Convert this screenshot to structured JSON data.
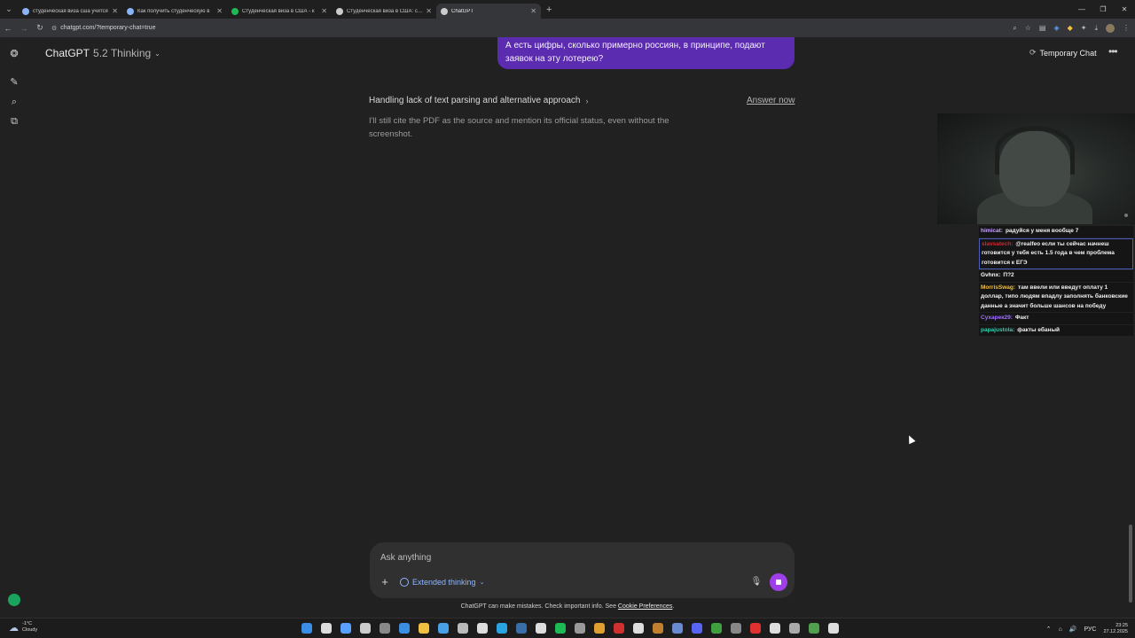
{
  "browser": {
    "tabs": [
      {
        "title": "студенческая виза сша учится",
        "favicon_color": "#8ab4f8"
      },
      {
        "title": "Как получить студенческую в",
        "favicon_color": "#8ab4f8"
      },
      {
        "title": "Студенческая виза в США - к",
        "favicon_color": "#1db954"
      },
      {
        "title": "Студенческая виза в США: сам",
        "favicon_color": "#cccccc"
      },
      {
        "title": "ChatGPT",
        "favicon_color": "#cccccc",
        "active": true
      }
    ],
    "url": "chatgpt.com/?temporary-chat=true"
  },
  "header": {
    "model_name": "ChatGPT",
    "model_version": "5.2 Thinking",
    "temporary_chat_label": "Temporary Chat"
  },
  "conversation": {
    "user_message": "А есть цифры, сколько примерно россиян, в принципе, подают заявок на эту лотерею?",
    "thinking_title": "Handling lack of text parsing and alternative approach",
    "answer_now_label": "Answer now",
    "thinking_text": "I'll still cite the PDF as the source and mention its official status, even without the screenshot."
  },
  "stream_chat": [
    {
      "user": "himicat",
      "color": "#c8a4ff",
      "text": "радуйся у меня вообще 7"
    },
    {
      "user": "slavsatech",
      "color": "#e0202e",
      "text": "@realfeo если ты сейчас начнеш готовится у тебя есть 1.5 года в чем проблема готовится к ЕГЭ",
      "highlight": true
    },
    {
      "user": "Gvhnx",
      "color": "#ffffff",
      "text": "П?2"
    },
    {
      "user": "MorrisSwag",
      "color": "#f0c040",
      "text": "там ввели или введут оплату 1 доллар, типо людям впадлу заполнять банковские данные а значит больше шансов на победу"
    },
    {
      "user": "Сухарек29",
      "color": "#a070ff",
      "text": "Факт"
    },
    {
      "user": "papajustola",
      "color": "#30d0b0",
      "text": "факты ебаный"
    }
  ],
  "composer": {
    "placeholder": "Ask anything",
    "extended_thinking_label": "Extended thinking"
  },
  "footer": {
    "disclaimer": "ChatGPT can make mistakes. Check important info. See",
    "cookie_link": "Cookie Preferences",
    "period": "."
  },
  "taskbar": {
    "weather_temp": "-1°C",
    "weather_desc": "Cloudy",
    "language": "РУС",
    "time": "23:25",
    "date": "27.12.2025",
    "apps": [
      {
        "name": "start-icon",
        "color": "#3a8ee6"
      },
      {
        "name": "search-icon",
        "color": "#dddddd"
      },
      {
        "name": "widgets-icon",
        "color": "#5aa0ff"
      },
      {
        "name": "terminal-icon",
        "color": "#cccccc"
      },
      {
        "name": "obs-icon",
        "color": "#888888"
      },
      {
        "name": "vscode-icon",
        "color": "#3b8fe0"
      },
      {
        "name": "explorer-icon",
        "color": "#f0c040"
      },
      {
        "name": "store-icon",
        "color": "#4aa0e6"
      },
      {
        "name": "tool-icon",
        "color": "#bbbbbb"
      },
      {
        "name": "calendar-icon",
        "color": "#dddddd"
      },
      {
        "name": "telegram-icon",
        "color": "#2aa4e0"
      },
      {
        "name": "steam-icon",
        "color": "#3a6ea8"
      },
      {
        "name": "chatgpt-icon",
        "color": "#dddddd"
      },
      {
        "name": "spotify-icon",
        "color": "#1db954"
      },
      {
        "name": "app-icon",
        "color": "#999999"
      },
      {
        "name": "chrome-icon",
        "color": "#e0a030"
      },
      {
        "name": "app-x-icon",
        "color": "#d03030"
      },
      {
        "name": "github-icon",
        "color": "#dddddd"
      },
      {
        "name": "folder-icon",
        "color": "#c08030"
      },
      {
        "name": "globe-icon",
        "color": "#6a8ad0"
      },
      {
        "name": "discord-icon",
        "color": "#5865f2"
      },
      {
        "name": "minecraft-icon",
        "color": "#40a040"
      },
      {
        "name": "monitor-icon",
        "color": "#888888"
      },
      {
        "name": "yandex-icon",
        "color": "#e03030"
      },
      {
        "name": "hotkey-icon",
        "color": "#dddddd"
      },
      {
        "name": "console-icon",
        "color": "#aaaaaa"
      },
      {
        "name": "browser-icon",
        "color": "#50a050"
      },
      {
        "name": "mouse-icon",
        "color": "#dddddd"
      }
    ]
  }
}
